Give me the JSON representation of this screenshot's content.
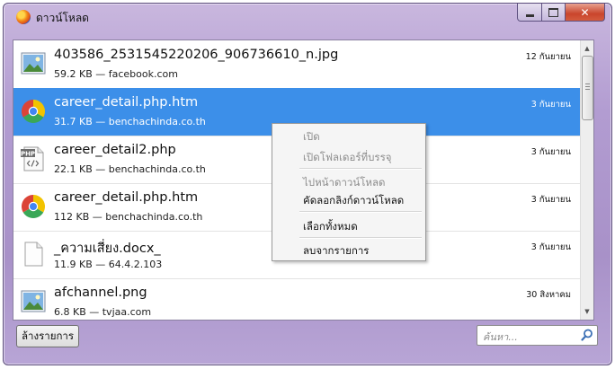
{
  "window": {
    "title": "ดาวน์โหลด"
  },
  "downloads": [
    {
      "name": "403586_2531545220206_906736610_n.jpg",
      "meta": "59.2 KB — facebook.com",
      "date": "12 กันยายน",
      "icon": "image-file-icon",
      "selected": false
    },
    {
      "name": "career_detail.php.htm",
      "meta": "31.7 KB — benchachinda.co.th",
      "date": "3 กันยายน",
      "icon": "chrome-icon",
      "selected": true
    },
    {
      "name": "career_detail2.php",
      "meta": "22.1 KB — benchachinda.co.th",
      "date": "3 กันยายน",
      "icon": "php-file-icon",
      "selected": false
    },
    {
      "name": "career_detail.php.htm",
      "meta": "112 KB — benchachinda.co.th",
      "date": "3 กันยายน",
      "icon": "chrome-icon",
      "selected": false
    },
    {
      "name": "_ความเสี่ยง.docx_",
      "meta": "11.9 KB — 64.4.2.103",
      "date": "3 กันยายน",
      "icon": "blank-file-icon",
      "selected": false
    },
    {
      "name": "afchannel.png",
      "meta": "6.8 KB — tvjaa.com",
      "date": "30 สิงหาคม",
      "icon": "image-file-icon",
      "selected": false
    }
  ],
  "context_menu": {
    "items": [
      {
        "label": "เปิด",
        "disabled": true
      },
      {
        "label": "เปิดโฟลเดอร์ที่บรรจุ",
        "disabled": true
      },
      {
        "label": "ไปหน้าดาวน์โหลด",
        "disabled": true
      },
      {
        "label": "คัดลอกลิงก์ดาวน์โหลด",
        "disabled": false
      },
      {
        "label": "เลือกทั้งหมด",
        "disabled": false
      },
      {
        "label": "ลบจากรายการ",
        "disabled": false
      }
    ]
  },
  "footer": {
    "clear_label": "ล้างรายการ",
    "search_placeholder": "ค้นหา..."
  },
  "colors": {
    "selection": "#3c8fe9",
    "frame": "#b29cd1"
  }
}
